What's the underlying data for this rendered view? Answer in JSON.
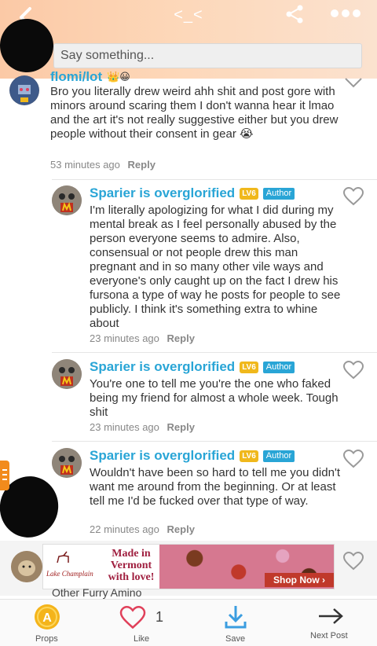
{
  "header": {
    "title": "<_<",
    "back_icon": "chevron-left-icon",
    "share_icon": "share-icon",
    "more_icon": "more-dots-icon",
    "gradient": [
      "#fbc9a6",
      "#fbe2cf"
    ]
  },
  "comment_input": {
    "placeholder": "Say something..."
  },
  "comments": [
    {
      "username": "flomi/lot",
      "text": "Bro you literally drew weird ahh shit  and post gore with minors around scaring them I don't wanna hear it lmao and the art it's not really suggestive either but you drew people without their consent in gear 😭",
      "time": "53 minutes ago",
      "reply": "Reply"
    },
    {
      "username": "Sparier is overglorified",
      "level": "LV6",
      "badge": "Author",
      "text": "I'm literally apologizing for what I did during my mental break as I feel personally abused by the person everyone seems to admire. Also, consensual or not people drew this man pregnant and in so many other vile ways and everyone's only caught up on the fact I drew his fursona a type of way he posts for people to see publicly. I think it's something extra to whine about",
      "time": "23 minutes ago",
      "reply": "Reply"
    },
    {
      "username": "Sparier is overglorified",
      "level": "LV6",
      "badge": "Author",
      "text": "You're one to tell me you're the one who faked being my friend for almost a whole week. Tough shit",
      "time": "23 minutes ago",
      "reply": "Reply"
    },
    {
      "username": "Sparier is overglorified",
      "level": "LV6",
      "badge": "Author",
      "text": "Wouldn't have been so hard to tell me you didn't want me around from the beginning. Or at least tell me I'd be fucked over that type of way.",
      "time": "22 minutes ago",
      "reply": "Reply"
    }
  ],
  "ad": {
    "logo": "Lake Champlain",
    "headline": "Made in Vermont with love!",
    "cta": "Shop Now ›",
    "footer_text": "Other Furry Amino"
  },
  "bottom_bar": {
    "props": "Props",
    "like_count": "1",
    "like": "Like",
    "save": "Save",
    "next": "Next Post"
  },
  "colors": {
    "username": "#29a5d6",
    "author_badge": "#29a5d6",
    "level_badge": "#f0b81c",
    "save_icon": "#3b9de0"
  }
}
